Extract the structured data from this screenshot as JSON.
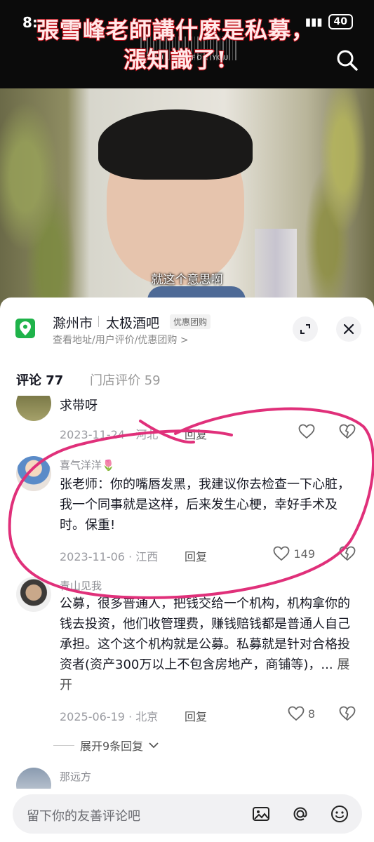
{
  "status_bar": {
    "time": "8:",
    "battery": "40"
  },
  "video": {
    "overlay_title": "張雪峰老師講什麼是私募，漲知識了!",
    "barcode_text": "BURNED FOR YOU",
    "subtitle": "就这个意思啊"
  },
  "poi": {
    "city": "滁州市",
    "name": "太极酒吧",
    "tag": "优惠团购",
    "sub": "查看地址/用户评价/优惠团购 >"
  },
  "tabs": {
    "comments": "评论 77",
    "store_reviews": "门店评价 59"
  },
  "comments": [
    {
      "name": "",
      "text": "求带呀",
      "date": "2023-11-24 · 河北",
      "reply": "回复",
      "likes": ""
    },
    {
      "name": "喜气洋洋🌷",
      "text": "张老师：你的嘴唇发黑，我建议你去检查一下心脏，我一个同事就是这样，后来发生心梗，幸好手术及时。保重!",
      "date": "2023-11-06 · 江西",
      "reply": "回复",
      "likes": "149"
    },
    {
      "name": "青山见我",
      "text": "公募，很多普通人，把钱交给一个机构，机构拿你的钱去投资，他们收管理费，赚钱赔钱都是普通人自己承担。这个这个机构就是公募。私募就是针对合格投资者(资产300万以上不包含房地产，商铺等)，...",
      "more": "展开",
      "date": "2025-06-19 · 北京",
      "reply": "回复",
      "likes": "8"
    },
    {
      "name": "那远方"
    }
  ],
  "expand_replies": "展开9条回复",
  "input": {
    "placeholder": "留下你的友善评论吧"
  },
  "colors": {
    "accent_green": "#1fb34a",
    "scribble": "#e0307a"
  },
  "icons": [
    "search-icon",
    "location-pin-icon",
    "expand-icon",
    "close-icon",
    "heart-icon",
    "dislike-icon",
    "chevron-down-icon",
    "image-icon",
    "at-icon",
    "emoji-icon"
  ]
}
